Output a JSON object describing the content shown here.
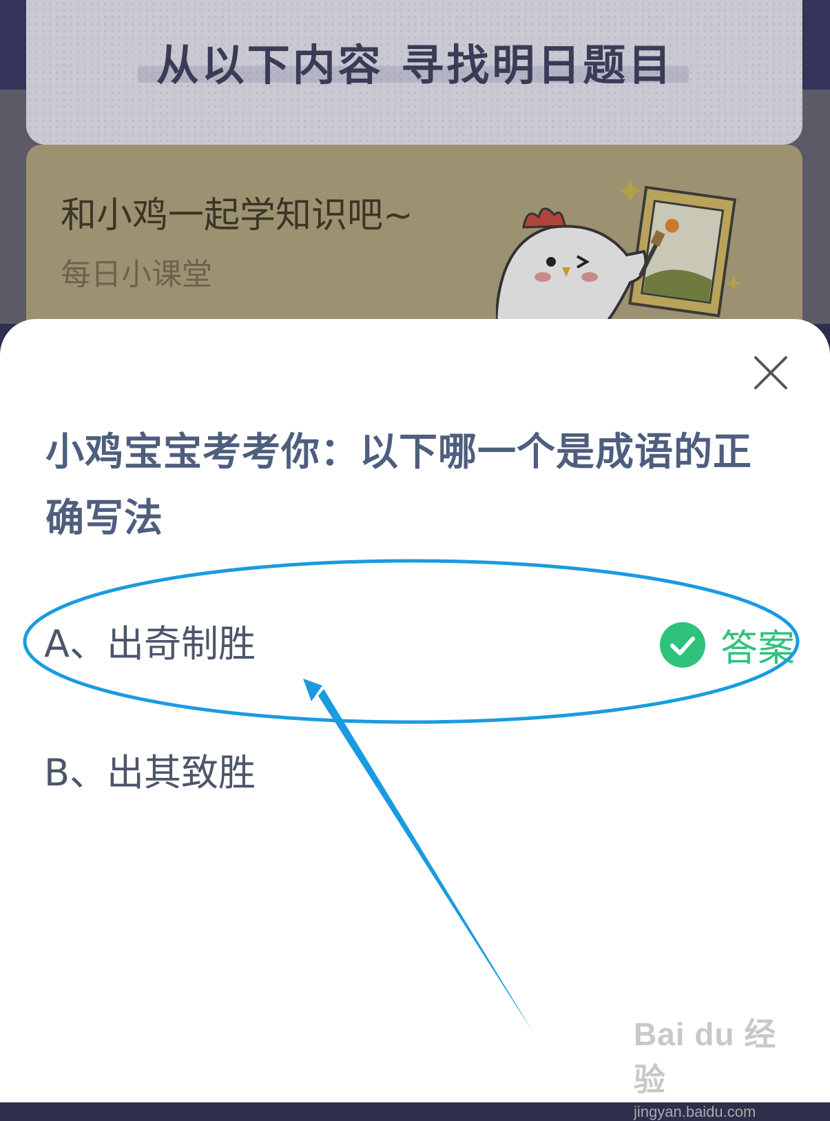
{
  "background": {
    "heading": "从以下内容  寻找明日题目",
    "card": {
      "title": "和小鸡一起学知识吧~",
      "subtitle": "每日小课堂"
    }
  },
  "dialog": {
    "close_icon": "close-icon",
    "question": "小鸡宝宝考考你：以下哪一个是成语的正确写法",
    "options": [
      {
        "label": "A、出奇制胜",
        "is_answer": true
      },
      {
        "label": "B、出其致胜",
        "is_answer": false
      }
    ],
    "answer_tag": "答案",
    "answer_icon": "check-circle-icon"
  },
  "colors": {
    "question": "#4e5e7e",
    "answer_green": "#2fc27c",
    "annotation_blue": "#1a9be0"
  },
  "watermark": {
    "logo": "Bai du 经验",
    "url": "jingyan.baidu.com"
  }
}
